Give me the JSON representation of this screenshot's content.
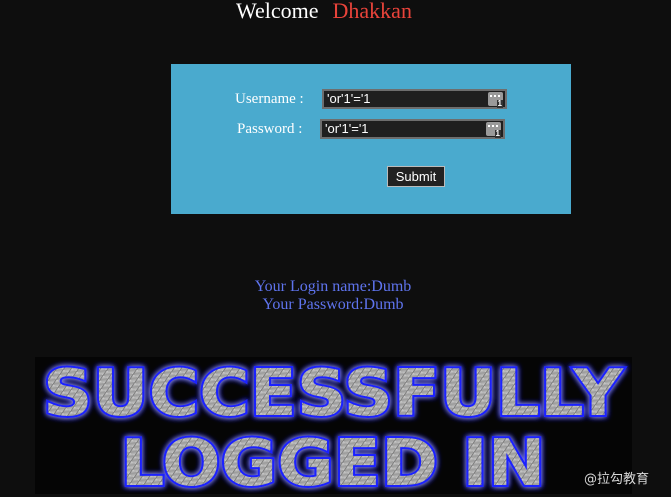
{
  "header": {
    "welcome": "Welcome",
    "name": "Dhakkan"
  },
  "form": {
    "username_label": "Username :",
    "username_value": "'or'1'='1",
    "password_label": "Password :",
    "password_value": "'or'1'='1",
    "submit_label": "Submit",
    "field_icon": "password-manager-icon"
  },
  "result": {
    "login_name": "Your Login name:Dumb",
    "password": "Your Password:Dumb"
  },
  "banner": {
    "line1": "SUCCESSFULLY",
    "line2": "LOGGED IN"
  },
  "watermark": "@拉勾教育",
  "colors": {
    "background": "#0e0e0e",
    "box": "#4aaace",
    "name": "#e8433a",
    "result_text": "#5f74ee",
    "banner_glow": "#1a22ff"
  }
}
